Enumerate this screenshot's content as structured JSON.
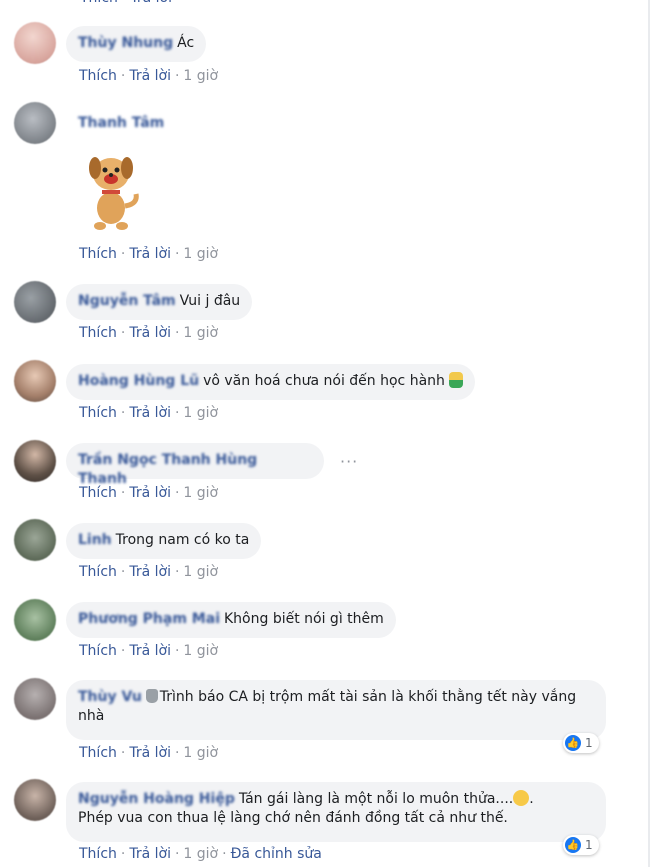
{
  "actions": {
    "like": "Thích",
    "reply": "Trả lời",
    "sep": "·",
    "edited": "Đã chỉnh sửa"
  },
  "comments": [
    {
      "name": "Thùy Nhung",
      "text": "Ác",
      "time": "1 giờ"
    },
    {
      "name": "Thanh Tâm",
      "sticker": "dog-sticker",
      "time": "1 giờ"
    },
    {
      "name": "Nguyễn Tâm",
      "text": "Vui j đâu",
      "time": "1 giờ"
    },
    {
      "name": "Hoàng Hùng Lũ",
      "text": "vô văn hoá chưa nói đến học hành",
      "emoji": "person-gesturing-no",
      "time": "1 giờ"
    },
    {
      "name": "Trần Ngọc Thanh Hùng Thanh",
      "text": "",
      "time": "1 giờ",
      "more": "···"
    },
    {
      "name": "Linh",
      "text": "Trong nam có ko ta",
      "time": "1 giờ"
    },
    {
      "name": "Phương Phạm Mai",
      "text": "Không biết nói gì thêm",
      "time": "1 giờ"
    },
    {
      "name": "Thùy Vu",
      "text": "Trình báo CA bị trộm mất tài sản là khối thằng tết này vắng nhà",
      "time": "1 giờ",
      "reactions": "1"
    },
    {
      "name": "Nguyễn Hoàng Hiệp",
      "text": "Tán gái làng là một nỗi lo muôn thửa....",
      "text2": "Phép vua con thua lệ làng chớ nên đánh đồng tất cả như thế.",
      "time": "1 giờ",
      "reactions": "1",
      "edited": true
    }
  ]
}
